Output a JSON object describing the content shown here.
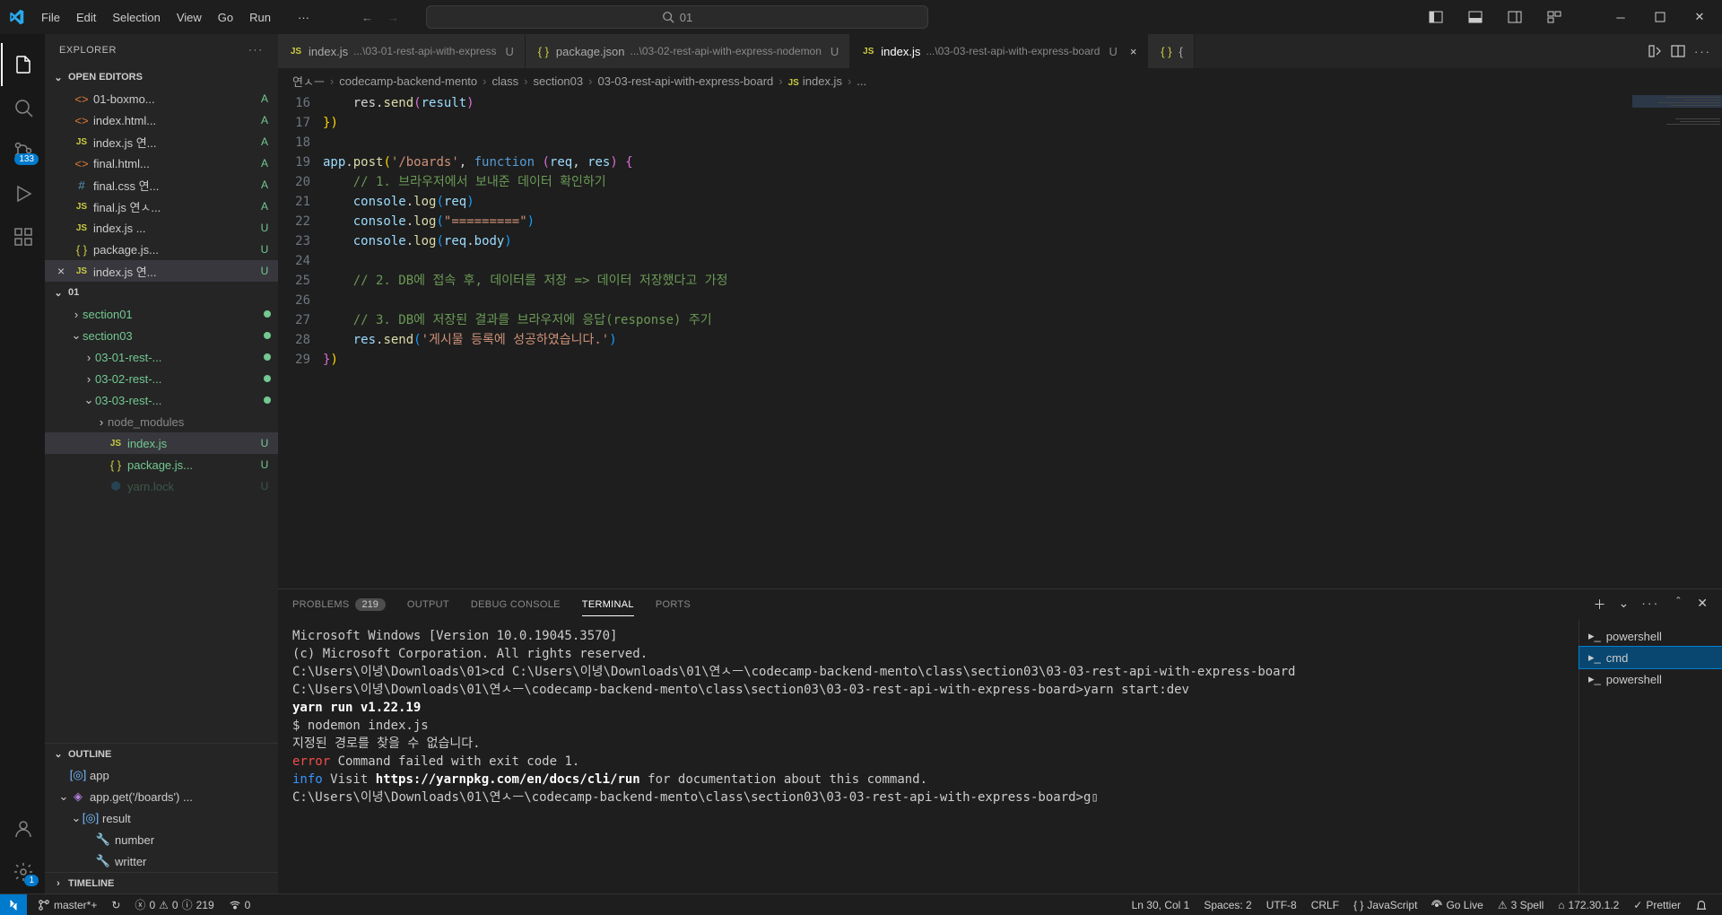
{
  "menubar": {
    "file": "File",
    "edit": "Edit",
    "selection": "Selection",
    "view": "View",
    "go": "Go",
    "run": "Run"
  },
  "titlebar": {
    "search_text": "01"
  },
  "sidebar": {
    "title": "EXPLORER",
    "open_editors": "OPEN EDITORS",
    "workspace": "01",
    "outline": "OUTLINE",
    "timeline": "TIMELINE",
    "open_items": [
      {
        "icon": "html",
        "label": "01-boxmo...",
        "status": "A"
      },
      {
        "icon": "html",
        "label": "index.html...",
        "status": "A"
      },
      {
        "icon": "js",
        "label": "index.js 연...",
        "status": "A"
      },
      {
        "icon": "html",
        "label": "final.html...",
        "status": "A"
      },
      {
        "icon": "css",
        "label": "final.css 연...",
        "status": "A"
      },
      {
        "icon": "js",
        "label": "final.js 연ㅅ...",
        "status": "A"
      },
      {
        "icon": "js",
        "label": "index.js ...",
        "status": "U"
      },
      {
        "icon": "json",
        "label": "package.js...",
        "status": "U"
      },
      {
        "icon": "js",
        "label": "index.js 연...",
        "status": "U",
        "active": true
      }
    ],
    "tree_nodes": [
      {
        "indent": 1,
        "chev": "›",
        "icon": "",
        "label": "section01",
        "dot": "#73c991"
      },
      {
        "indent": 1,
        "chev": "⌄",
        "icon": "",
        "label": "section03",
        "dot": "#73c991"
      },
      {
        "indent": 2,
        "chev": "›",
        "icon": "",
        "label": "03-01-rest-...",
        "dot": "#73c991"
      },
      {
        "indent": 2,
        "chev": "›",
        "icon": "",
        "label": "03-02-rest-...",
        "dot": "#73c991"
      },
      {
        "indent": 2,
        "chev": "⌄",
        "icon": "",
        "label": "03-03-rest-...",
        "dot": "#73c991"
      },
      {
        "indent": 3,
        "chev": "›",
        "icon": "",
        "label": "node_modules",
        "dim": true
      },
      {
        "indent": 3,
        "chev": "",
        "icon": "js",
        "label": "index.js",
        "status": "U",
        "active": true
      },
      {
        "indent": 3,
        "chev": "",
        "icon": "json",
        "label": "package.js...",
        "status": "U"
      },
      {
        "indent": 3,
        "chev": "",
        "icon": "yarn",
        "label": "yarn.lock",
        "status": "U",
        "faded": true
      }
    ],
    "outline_items": [
      {
        "indent": 0,
        "chev": "",
        "icon": "cube",
        "label": "app"
      },
      {
        "indent": 0,
        "chev": "⌄",
        "icon": "method",
        "label": "app.get('/boards') ..."
      },
      {
        "indent": 1,
        "chev": "⌄",
        "icon": "cube",
        "label": "result"
      },
      {
        "indent": 2,
        "chev": "",
        "icon": "wrench",
        "label": "number"
      },
      {
        "indent": 2,
        "chev": "",
        "icon": "wrench",
        "label": "writter"
      }
    ]
  },
  "tabs": [
    {
      "icon": "js",
      "name": "index.js",
      "path": "...\\03-01-rest-api-with-express",
      "status": "U"
    },
    {
      "icon": "json",
      "name": "package.json",
      "path": "...\\03-02-rest-api-with-express-nodemon",
      "status": "U"
    },
    {
      "icon": "js",
      "name": "index.js",
      "path": "...\\03-03-rest-api-with-express-board",
      "status": "U",
      "active": true,
      "close": true
    },
    {
      "icon": "json_partial",
      "name": "{",
      "path": "",
      "status": ""
    }
  ],
  "breadcrumb": [
    "연ㅅㅡ",
    "codecamp-backend-mento",
    "class",
    "section03",
    "03-03-rest-api-with-express-board",
    "index.js",
    "..."
  ],
  "breadcrumb_icon": "js",
  "code": {
    "start": 16,
    "lines": [
      {
        "n": 16,
        "html": "    res.<span class='tk-fn'>send</span><span class='tk-br2'>(</span><span class='tk-var'>result</span><span class='tk-br2'>)</span>"
      },
      {
        "n": 17,
        "html": "<span class='tk-br'>}</span><span class='tk-br'>)</span>"
      },
      {
        "n": 18,
        "html": ""
      },
      {
        "n": 19,
        "html": "<span class='tk-var'>app</span>.<span class='tk-fn'>post</span><span class='tk-br'>(</span><span class='tk-str'>'/boards'</span>, <span class='tk-kw'>function</span> <span class='tk-br2'>(</span><span class='tk-var'>req</span>, <span class='tk-var'>res</span><span class='tk-br2'>)</span> <span class='tk-br2'>{</span>"
      },
      {
        "n": 20,
        "html": "    <span class='tk-com'>// 1. 브라우저에서 보내준 데이터 확인하기</span>"
      },
      {
        "n": 21,
        "html": "    <span class='tk-var'>console</span>.<span class='tk-fn'>log</span><span class='tk-br3'>(</span><span class='tk-var'>req</span><span class='tk-br3'>)</span>"
      },
      {
        "n": 22,
        "html": "    <span class='tk-var'>console</span>.<span class='tk-fn'>log</span><span class='tk-br3'>(</span><span class='tk-str'>\"=========\"</span><span class='tk-br3'>)</span>"
      },
      {
        "n": 23,
        "html": "    <span class='tk-var'>console</span>.<span class='tk-fn'>log</span><span class='tk-br3'>(</span><span class='tk-var'>req</span>.<span class='tk-var'>body</span><span class='tk-br3'>)</span>"
      },
      {
        "n": 24,
        "html": ""
      },
      {
        "n": 25,
        "html": "    <span class='tk-com'>// 2. DB에 접속 후, 데이터를 저장 =&gt; 데이터 저장했다고 가정</span>"
      },
      {
        "n": 26,
        "html": ""
      },
      {
        "n": 27,
        "html": "    <span class='tk-com'>// 3. DB에 저장된 결과를 브라우저에 응답(response) 주기</span>"
      },
      {
        "n": 28,
        "html": "    <span class='tk-var'>res</span>.<span class='tk-fn'>send</span><span class='tk-br3'>(</span><span class='tk-str'>'게시물 등록에 성공하였습니다.'</span><span class='tk-br3'>)</span>"
      },
      {
        "n": 29,
        "html": "<span class='tk-br2'>}</span><span class='tk-br'>)</span>"
      }
    ]
  },
  "panel": {
    "tabs": {
      "problems": "PROBLEMS",
      "problems_count": "219",
      "output": "OUTPUT",
      "debug": "DEBUG CONSOLE",
      "terminal": "TERMINAL",
      "ports": "PORTS"
    },
    "terminal_lines": [
      {
        "t": "Microsoft Windows [Version 10.0.19045.3570]"
      },
      {
        "t": "(c) Microsoft Corporation. All rights reserved."
      },
      {
        "t": ""
      },
      {
        "t": "C:\\Users\\이녕\\Downloads\\01>cd C:\\Users\\이녕\\Downloads\\01\\연ㅅㅡ\\codecamp-backend-mento\\class\\section03\\03-03-rest-api-with-express-board"
      },
      {
        "t": ""
      },
      {
        "t": "C:\\Users\\이녕\\Downloads\\01\\연ㅅㅡ\\codecamp-backend-mento\\class\\section03\\03-03-rest-api-with-express-board>yarn start:dev"
      },
      {
        "cls": "t-bold",
        "t": "yarn run v1.22.19"
      },
      {
        "t": "$ nodemon index.js"
      },
      {
        "t": "지정된 경로를 찾을 수 없습니다."
      },
      {
        "html": "<span class='t-err'>error</span> Command failed with exit code 1."
      },
      {
        "html": "<span class='t-info'>info</span> Visit <span class='t-bold'>https://yarnpkg.com/en/docs/cli/run</span> for documentation about this command."
      },
      {
        "t": ""
      },
      {
        "t": "C:\\Users\\이녕\\Downloads\\01\\연ㅅㅡ\\codecamp-backend-mento\\class\\section03\\03-03-rest-api-with-express-board>g▯"
      }
    ],
    "terminals": [
      {
        "icon": "pwsh",
        "label": "powershell"
      },
      {
        "icon": "cmd",
        "label": "cmd",
        "active": true
      },
      {
        "icon": "pwsh",
        "label": "powershell"
      }
    ]
  },
  "statusbar": {
    "branch": "master*+",
    "sync": "↻",
    "err": "0",
    "warn": "0",
    "info": "219",
    "port": "0",
    "cursor": "Ln 30, Col 1",
    "spaces": "Spaces: 2",
    "encoding": "UTF-8",
    "eol": "CRLF",
    "lang": "JavaScript",
    "golive": "Go Live",
    "spell": "3 Spell",
    "ip": "172.30.1.2",
    "prettier": "Prettier"
  },
  "activity_badge": "133"
}
